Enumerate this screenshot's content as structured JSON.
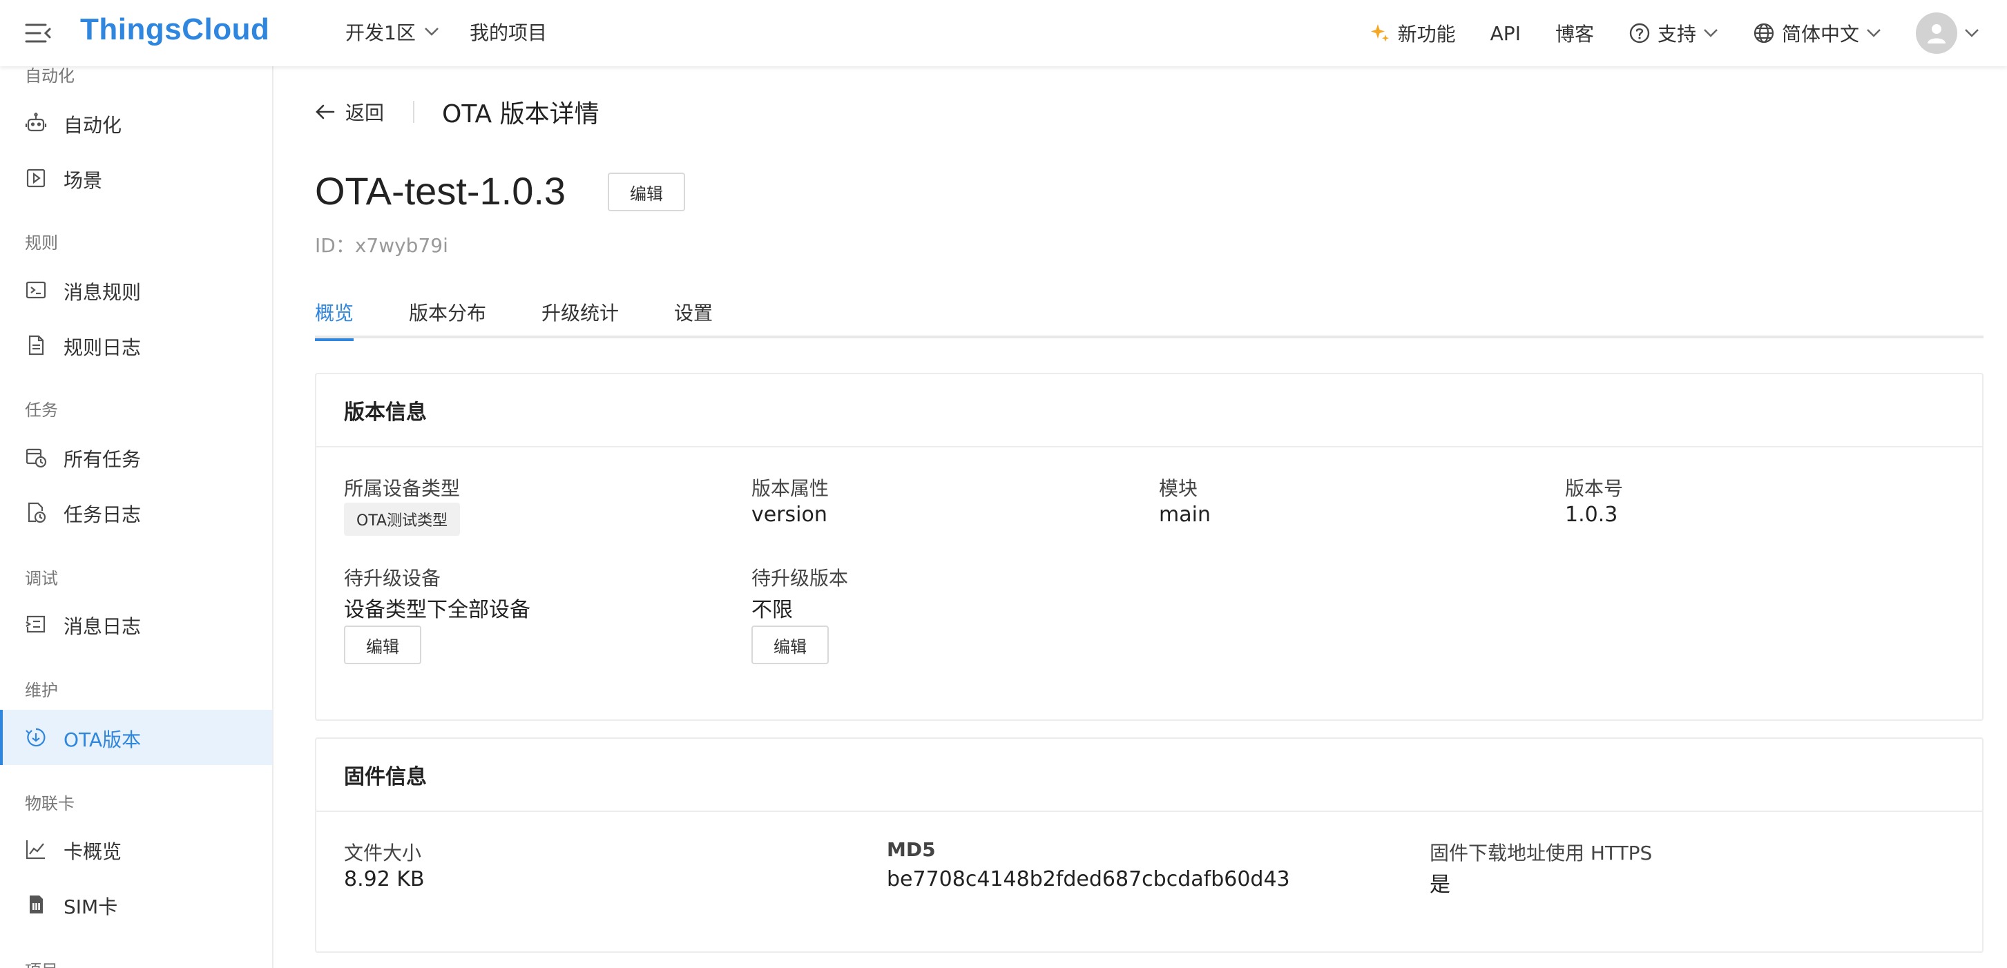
{
  "header": {
    "logo": "ThingsCloud",
    "region": "开发1区",
    "my_projects": "我的项目",
    "new_features": "新功能",
    "api": "API",
    "blog": "博客",
    "support": "支持",
    "language": "简体中文",
    "accent_color": "#2f86de",
    "new_feature_icon_color": "#f5a623"
  },
  "sidebar": {
    "top_partial_group": "自动化",
    "groups": [
      {
        "label": "规则"
      },
      {
        "label": "任务"
      },
      {
        "label": "调试"
      },
      {
        "label": "维护"
      },
      {
        "label": "物联卡"
      },
      {
        "label": "项目"
      }
    ],
    "items": [
      {
        "label": "自动化",
        "icon": "robot-icon"
      },
      {
        "label": "场景",
        "icon": "play-square-icon"
      },
      {
        "label": "消息规则",
        "icon": "terminal-icon"
      },
      {
        "label": "规则日志",
        "icon": "file-text-icon"
      },
      {
        "label": "所有任务",
        "icon": "schedule-icon"
      },
      {
        "label": "任务日志",
        "icon": "file-clock-icon"
      },
      {
        "label": "消息日志",
        "icon": "message-log-icon"
      },
      {
        "label": "OTA版本",
        "icon": "download-circle-icon",
        "active": true
      },
      {
        "label": "卡概览",
        "icon": "line-chart-icon"
      },
      {
        "label": "SIM卡",
        "icon": "sim-card-icon"
      }
    ]
  },
  "page": {
    "back_label": "返回",
    "title": "OTA 版本详情",
    "version_name": "OTA-test-1.0.3",
    "edit_label": "编辑",
    "id_line": "ID：x7wyb79i",
    "tabs": [
      {
        "label": "概览",
        "active": true
      },
      {
        "label": "版本分布"
      },
      {
        "label": "升级统计"
      },
      {
        "label": "设置"
      }
    ]
  },
  "version_info": {
    "title": "版本信息",
    "device_type_label": "所属设备类型",
    "device_type_value": "OTA测试类型",
    "version_attr_label": "版本属性",
    "version_attr_value": "version",
    "module_label": "模块",
    "module_value": "main",
    "version_no_label": "版本号",
    "version_no_value": "1.0.3",
    "pending_devices_label": "待升级设备",
    "pending_devices_value": "设备类型下全部设备",
    "pending_version_label": "待升级版本",
    "pending_version_value": "不限",
    "edit_label": "编辑"
  },
  "firmware_info": {
    "title": "固件信息",
    "size_label": "文件大小",
    "size_value": "8.92 KB",
    "md5_label": "MD5",
    "md5_value": "be7708c4148b2fded687cbcdafb60d43",
    "https_label": "固件下载地址使用 HTTPS",
    "https_value": "是"
  }
}
